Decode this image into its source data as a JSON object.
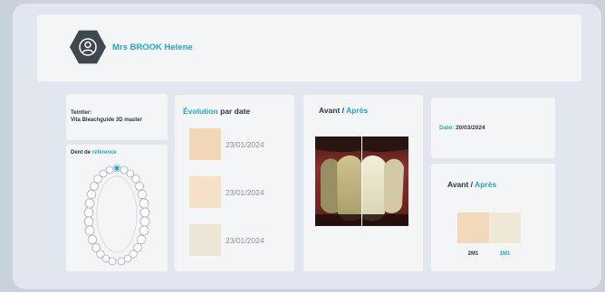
{
  "patient": {
    "name": "Mrs BROOK Helene",
    "avatar_icon": "user-icon"
  },
  "shade_guide": {
    "label": "Teintier:",
    "value": "Vita Bleachguide 3D master"
  },
  "reference_tooth": {
    "label_prefix": "Dent de ",
    "label_accent": "référence",
    "chart_icon": "dental-arch-chart-icon"
  },
  "evolution": {
    "title_accent": "Évolution",
    "title_rest": " par date",
    "entries": [
      {
        "date": "23/01/2024",
        "color": "#f1d7b6"
      },
      {
        "date": "23/01/2024",
        "color": "#f4e1c7"
      },
      {
        "date": "23/01/2024",
        "color": "#ece6d5"
      }
    ]
  },
  "before_after_photo": {
    "title_prefix": "Avant / ",
    "title_accent": "Après"
  },
  "session_date": {
    "label": "Date: ",
    "value": "20/03/2024"
  },
  "before_after_shade": {
    "title_prefix": "Avant / ",
    "title_accent": "Après",
    "before": {
      "code": "2M1",
      "color": "#f1d9b9"
    },
    "after": {
      "code": "1M1",
      "color": "#efe8d6"
    }
  },
  "colors": {
    "accent": "#23a6c6",
    "dark": "#2e3640",
    "icon_bg": "#3f474f"
  }
}
